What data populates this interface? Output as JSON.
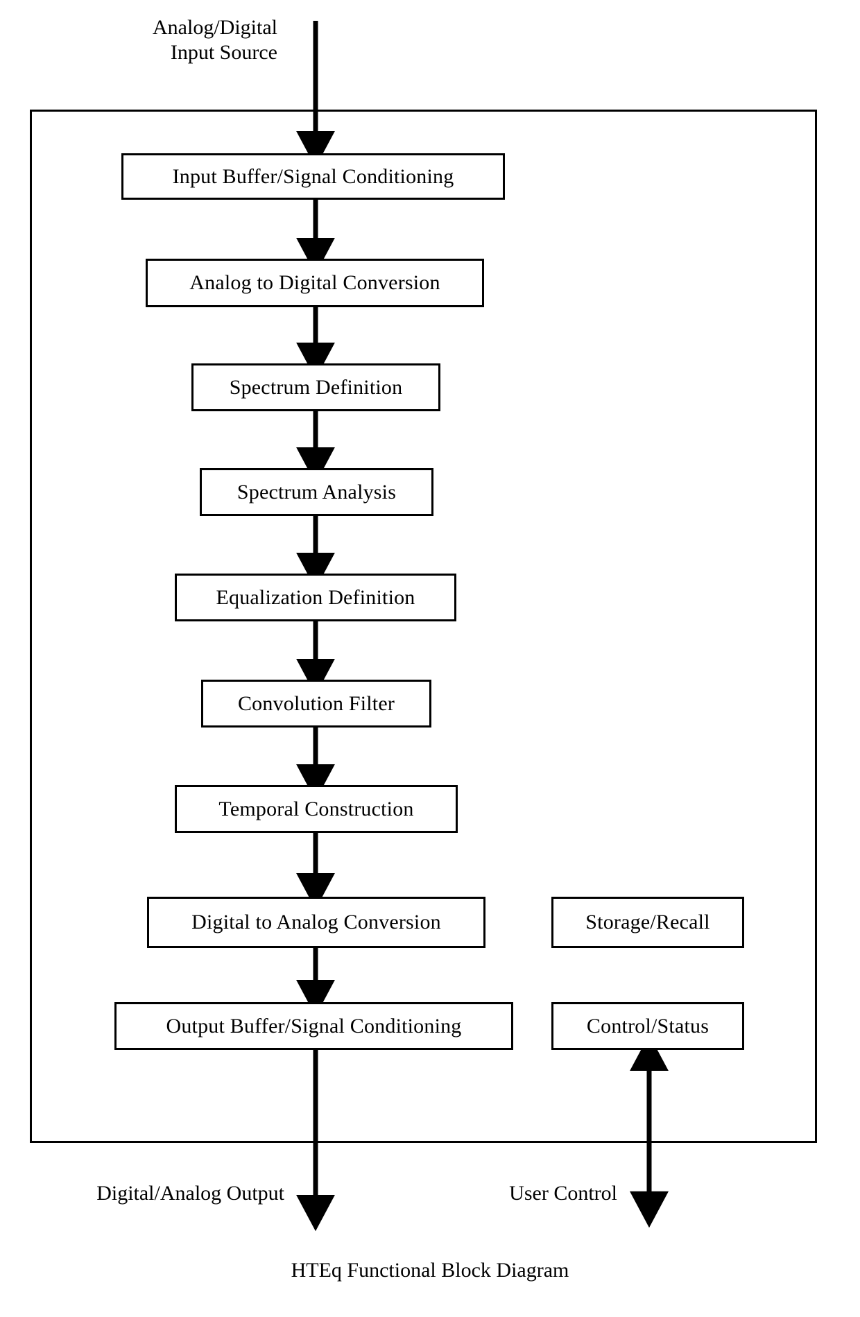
{
  "diagram": {
    "caption": "HTEq Functional Block Diagram",
    "colors": {
      "stroke": "#000000",
      "background": "#ffffff",
      "text": "#000000"
    },
    "external_labels": {
      "input_source": "Analog/Digital\nInput Source",
      "output": "Digital/Analog Output",
      "user_control": "User Control"
    },
    "blocks": [
      {
        "id": "input-buffer",
        "label": "Input Buffer/Signal Conditioning"
      },
      {
        "id": "analog-to-digital",
        "label": "Analog to Digital Conversion"
      },
      {
        "id": "spectrum-definition",
        "label": "Spectrum Definition"
      },
      {
        "id": "spectrum-analysis",
        "label": "Spectrum Analysis"
      },
      {
        "id": "equalization-definition",
        "label": "Equalization Definition"
      },
      {
        "id": "convolution-filter",
        "label": "Convolution Filter"
      },
      {
        "id": "temporal-construction",
        "label": "Temporal Construction"
      },
      {
        "id": "digital-to-analog",
        "label": "Digital to Analog Conversion"
      },
      {
        "id": "output-buffer",
        "label": "Output Buffer/Signal Conditioning"
      },
      {
        "id": "storage-recall",
        "label": "Storage/Recall"
      },
      {
        "id": "control-status",
        "label": "Control/Status"
      }
    ]
  }
}
